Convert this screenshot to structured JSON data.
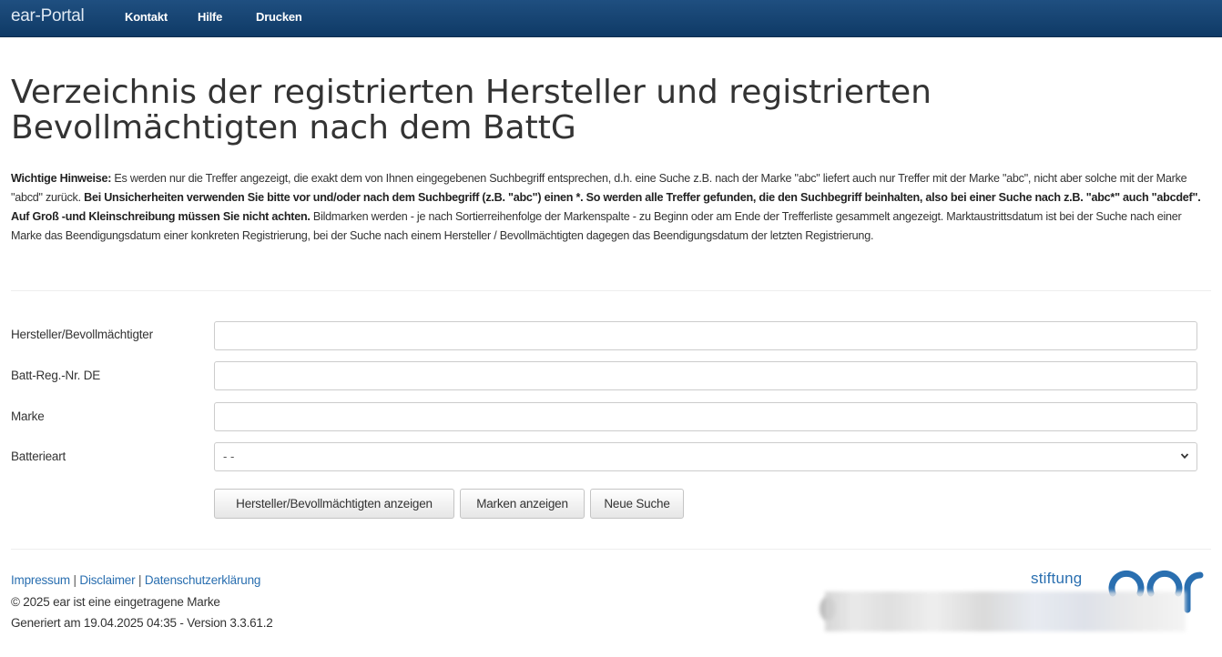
{
  "navbar": {
    "brand": "ear-Portal",
    "links": [
      "Kontakt",
      "Hilfe",
      "Drucken"
    ]
  },
  "page": {
    "title": "Verzeichnis der registrierten Hersteller und registrierten Bevollmächtigten nach dem BattG"
  },
  "hint": {
    "label": "Wichtige Hinweise:",
    "text1": " Es werden nur die Treffer angezeigt, die exakt dem von Ihnen eingegebenen Suchbegriff entsprechen, d.h. eine Suche z.B. nach der Marke \"abc\" liefert auch nur Treffer mit der Marke \"abc\", nicht aber solche mit der Marke \"abcd\" zurück. ",
    "bold": "Bei Unsicherheiten verwenden Sie bitte vor und/oder nach dem Suchbegriff (z.B. \"abc\") einen *. So werden alle Treffer gefunden, die den Suchbegriff beinhalten, also bei einer Suche nach z.B. \"abc*\" auch \"abcdef\". Auf Groß -und Kleinschreibung müssen Sie nicht achten.",
    "text2": " Bildmarken werden - je nach Sortierreihenfolge der Markenspalte - zu Beginn oder am Ende der Trefferliste gesammelt angezeigt. Marktaustrittsdatum ist bei der Suche nach einer Marke das Beendigungsdatum einer konkreten Registrierung, bei der Suche nach einem Hersteller / Bevollmächtigten dagegen das Beendigungsdatum der letzten Registrierung."
  },
  "form": {
    "manufacturer_label": "Hersteller/Bevollmächtigter",
    "manufacturer_value": "",
    "regnr_label": "Batt-Reg.-Nr. DE",
    "regnr_value": "",
    "brand_label": "Marke",
    "brand_value": "",
    "battery_type_label": "Batterieart",
    "battery_type_selected": "- -",
    "buttons": {
      "show_manufacturers": "Hersteller/Bevollmächtigten anzeigen",
      "show_brands": "Marken anzeigen",
      "new_search": "Neue Suche"
    }
  },
  "footer": {
    "links": [
      "Impressum",
      "Disclaimer",
      "Datenschutzerklärung"
    ],
    "separator": "|",
    "copyright": "© 2025 ear ist eine eingetragene Marke",
    "generated": "Generiert am 19.04.2025 04:35 - Version 3.3.61.2",
    "logo_text": "stiftung",
    "logo_mark": "ear"
  },
  "colors": {
    "navbar": "#0f3a66",
    "link": "#2a6fb0",
    "text": "#333333"
  }
}
